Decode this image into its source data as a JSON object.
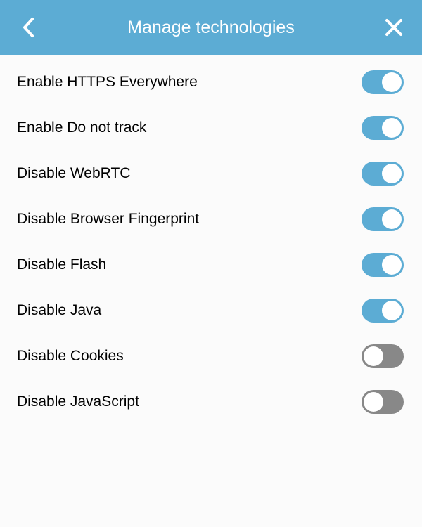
{
  "header": {
    "title": "Manage technologies"
  },
  "colors": {
    "accent": "#5cacd4",
    "toggle_off": "#888888"
  },
  "settings": [
    {
      "id": "https-everywhere",
      "label": "Enable HTTPS Everywhere",
      "value": true
    },
    {
      "id": "do-not-track",
      "label": "Enable Do not track",
      "value": true
    },
    {
      "id": "webrtc",
      "label": "Disable WebRTC",
      "value": true
    },
    {
      "id": "fingerprint",
      "label": "Disable Browser Fingerprint",
      "value": true
    },
    {
      "id": "flash",
      "label": "Disable Flash",
      "value": true
    },
    {
      "id": "java",
      "label": "Disable Java",
      "value": true
    },
    {
      "id": "cookies",
      "label": "Disable Cookies",
      "value": false
    },
    {
      "id": "javascript",
      "label": "Disable JavaScript",
      "value": false
    }
  ]
}
